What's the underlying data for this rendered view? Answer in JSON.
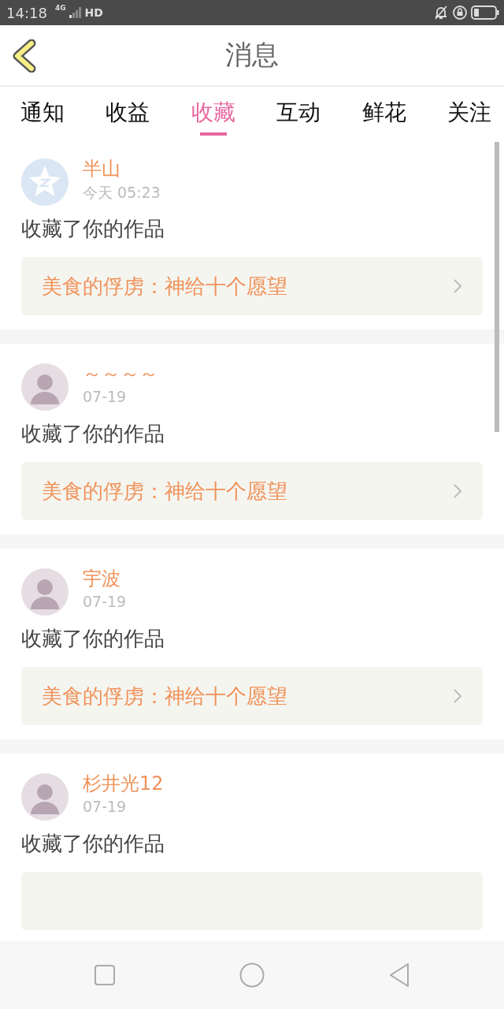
{
  "status_bar": {
    "time": "14:18",
    "network": "4G",
    "hd": "HD"
  },
  "header": {
    "title": "消息"
  },
  "tabs": [
    {
      "label": "通知",
      "selected": false
    },
    {
      "label": "收益",
      "selected": false
    },
    {
      "label": "收藏",
      "selected": true
    },
    {
      "label": "互动",
      "selected": false
    },
    {
      "label": "鲜花",
      "selected": false
    },
    {
      "label": "关注",
      "selected": false
    }
  ],
  "messages": [
    {
      "kind": "default",
      "name": "半山",
      "time": "今天 05:23",
      "action": "收藏了你的作品",
      "work": "美食的俘虏：神给十个愿望"
    },
    {
      "kind": "photo",
      "name": "～～～～",
      "time": "07-19",
      "action": "收藏了你的作品",
      "work": "美食的俘虏：神给十个愿望"
    },
    {
      "kind": "photo",
      "name": "宇波",
      "time": "07-19",
      "action": "收藏了你的作品",
      "work": "美食的俘虏：神给十个愿望"
    },
    {
      "kind": "photo",
      "name": "杉井光12",
      "time": "07-19",
      "action": "收藏了你的作品"
    }
  ]
}
